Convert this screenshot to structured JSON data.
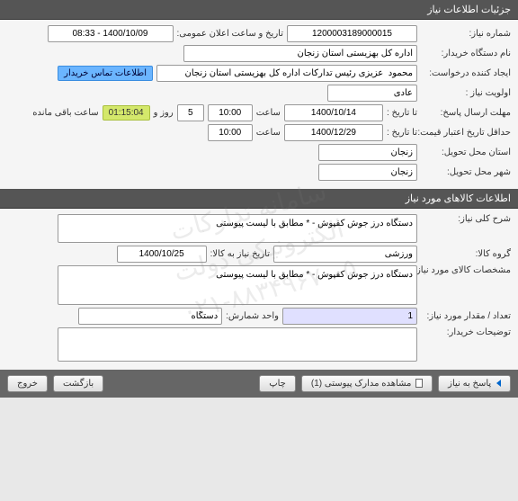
{
  "watermark": {
    "line1": "سامانه تدارکات الکترونیکی دولت",
    "line2": "۰۲۱-۸۸۳۴۹۶۷۰-۵"
  },
  "sections": {
    "need_info": "جزئیات اطلاعات نیاز",
    "goods_info": "اطلاعات کالاهای مورد نیاز"
  },
  "fields": {
    "need_number_label": "شماره نیاز:",
    "need_number": "1200003189000015",
    "announce_date_label": "تاریخ و ساعت اعلان عمومی:",
    "announce_date": "1400/10/09 - 08:33",
    "buyer_label": "نام دستگاه خریدار:",
    "buyer": "اداره کل بهزیستی استان زنجان",
    "requester_label": "ایجاد کننده درخواست:",
    "requester": "محمود  عزیزی رئیس تدارکات اداره کل بهزیستی استان زنجان",
    "requester_badge": "اطلاعات تماس خریدار",
    "priority_label": "اولویت نیاز :",
    "priority": "عادی",
    "deadline_label": "مهلت ارسال پاسخ:",
    "to_date_label": "تا تاریخ :",
    "deadline_date": "1400/10/14",
    "time_label": "ساعت",
    "deadline_time": "10:00",
    "days": "5",
    "days_label": "روز و",
    "remaining_time": "01:15:04",
    "remaining_label": "ساعت باقی مانده",
    "validity_label": "حداقل تاریخ اعتبار قیمت:",
    "validity_date": "1400/12/29",
    "validity_time": "10:00",
    "province_label": "استان محل تحویل:",
    "province": "زنجان",
    "city_label": "شهر محل تحویل:",
    "city": "زنجان",
    "desc_label": "شرح کلی نیاز:",
    "desc": "دستگاه درز جوش کفپوش - * مطابق با لیست پیوستی",
    "group_label": "گروه کالا:",
    "group": "ورزشی",
    "need_date_label": "تاریخ نیاز به کالا:",
    "need_date": "1400/10/25",
    "spec_label": "مشخصات کالای مورد نیاز:",
    "spec": "دستگاه درز جوش کفپوش - * مطابق با لیست پیوستی",
    "qty_label": "تعداد / مقدار مورد نیاز:",
    "qty": "1",
    "unit_label": "واحد شمارش:",
    "unit": "دستگاه",
    "buyer_notes_label": "توضیحات خریدار:",
    "buyer_notes": ""
  },
  "buttons": {
    "respond": "پاسخ به نیاز",
    "attachments": "مشاهده مدارک پیوستی (1)",
    "print": "چاپ",
    "back": "بازگشت",
    "exit": "خروج"
  }
}
